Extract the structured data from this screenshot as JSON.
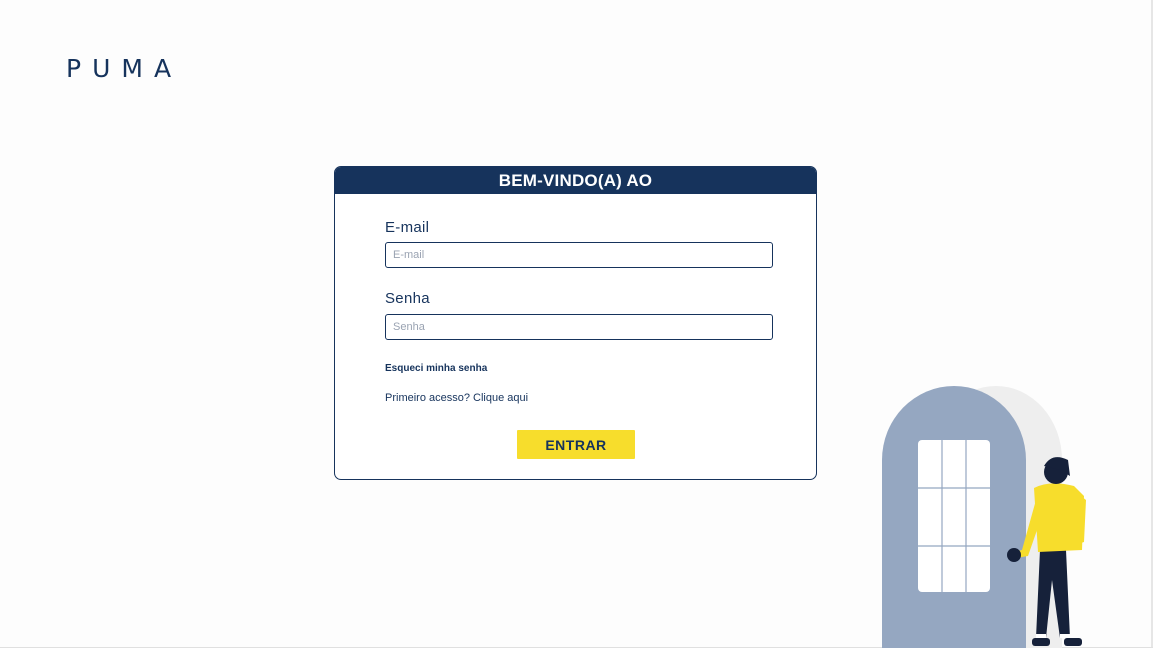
{
  "brand": {
    "logo_text": "PUMA"
  },
  "login": {
    "title": "BEM-VINDO(A) AO",
    "email": {
      "label": "E-mail",
      "placeholder": "E-mail",
      "value": ""
    },
    "password": {
      "label": "Senha",
      "placeholder": "Senha",
      "value": ""
    },
    "forgot_password": "Esqueci minha senha",
    "first_access": "Primeiro acesso? Clique aqui",
    "submit_label": "ENTRAR"
  },
  "colors": {
    "brand_navy": "#16335c",
    "button_yellow": "#f7dd2c",
    "door_blue": "#95a7c1",
    "shirt_yellow": "#f7dd2c"
  },
  "illustration": {
    "name": "person-at-door-illustration"
  }
}
